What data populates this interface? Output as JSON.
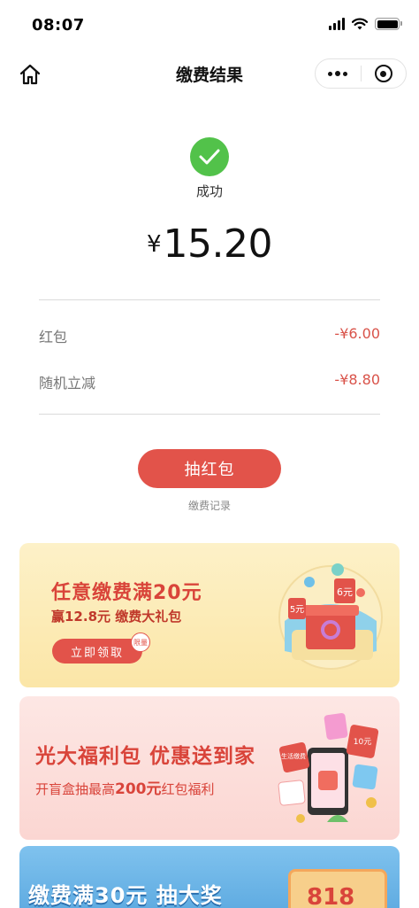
{
  "status_bar": {
    "time": "08:07"
  },
  "nav": {
    "title": "缴费结果"
  },
  "result": {
    "status": "成功",
    "currency_symbol": "¥",
    "amount": "15.20"
  },
  "discounts": [
    {
      "label": "红包",
      "value": "-¥6.00"
    },
    {
      "label": "随机立减",
      "value": "-¥8.80"
    }
  ],
  "actions": {
    "draw_button": "抽红包",
    "history_link": "缴费记录"
  },
  "banners": {
    "gift": {
      "title": "任意缴费满20元",
      "subtitle": "赢12.8元 缴费大礼包",
      "button": "立即领取",
      "tag": "限量",
      "coupon_values": [
        "5元",
        "6元"
      ]
    },
    "welfare": {
      "title": "光大福利包 优惠送到家",
      "subtitle_prefix": "开盲盒抽最高",
      "subtitle_amount": "200元",
      "subtitle_suffix": "红包福利",
      "card_labels": [
        "生活缴费",
        "10元"
      ]
    },
    "bottom": {
      "title": "缴费满30元 抽大奖",
      "box_text": "818"
    }
  },
  "colors": {
    "success_green": "#52c24a",
    "accent_red": "#e2534a",
    "discount_red": "#d9534a"
  }
}
